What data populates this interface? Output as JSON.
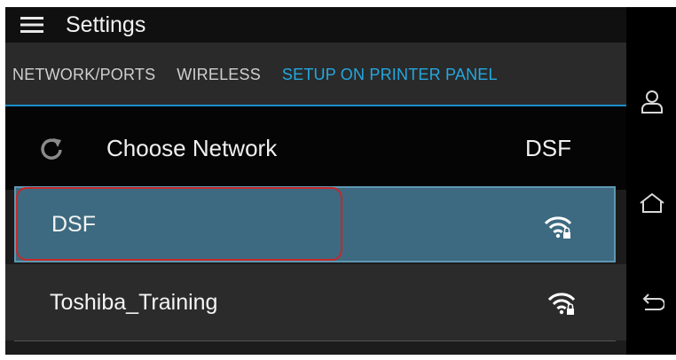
{
  "header": {
    "title": "Settings",
    "menu_icon": "hamburger-menu-icon"
  },
  "tabs": [
    {
      "label": "NETWORK/PORTS",
      "active": false
    },
    {
      "label": "WIRELESS",
      "active": false
    },
    {
      "label": "SETUP ON PRINTER PANEL",
      "active": true
    }
  ],
  "choose_network": {
    "icon": "refresh-icon",
    "label": "Choose Network",
    "value": "DSF"
  },
  "networks": [
    {
      "name": "DSF",
      "selected": true,
      "icon": "wifi-locked-icon"
    },
    {
      "name": "Toshiba_Training",
      "selected": false,
      "icon": "wifi-locked-icon"
    }
  ],
  "nav_bar": {
    "items": [
      "user-icon",
      "home-icon",
      "back-icon"
    ]
  },
  "colors": {
    "accent": "#24a8e0",
    "selected_row": "#3d6a80",
    "highlight": "#c62828"
  }
}
